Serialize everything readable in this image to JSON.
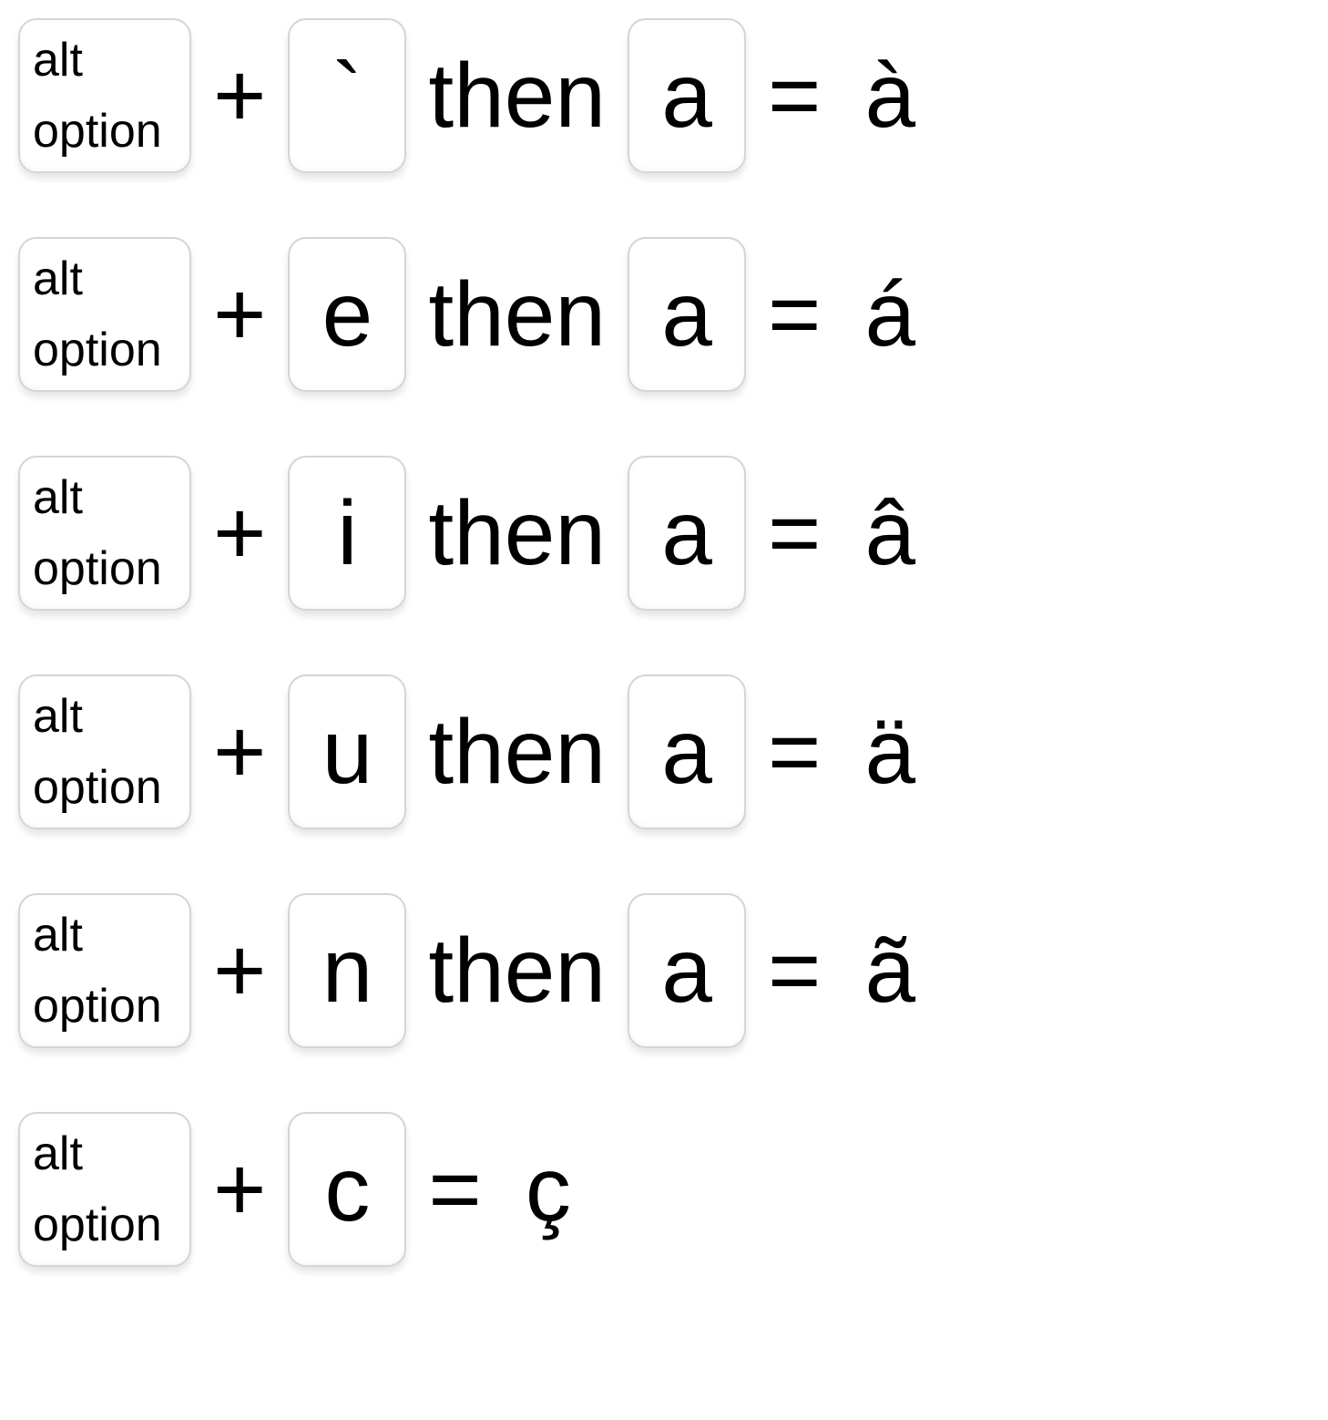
{
  "rows": [
    {
      "alt_top": "alt",
      "alt_bottom": "option",
      "plus": "+",
      "k1": "`",
      "then": "then",
      "k2": "a",
      "eq": "=",
      "out": "à"
    },
    {
      "alt_top": "alt",
      "alt_bottom": "option",
      "plus": "+",
      "k1": "e",
      "then": "then",
      "k2": "a",
      "eq": "=",
      "out": "á"
    },
    {
      "alt_top": "alt",
      "alt_bottom": "option",
      "plus": "+",
      "k1": "i",
      "then": "then",
      "k2": "a",
      "eq": "=",
      "out": "â"
    },
    {
      "alt_top": "alt",
      "alt_bottom": "option",
      "plus": "+",
      "k1": "u",
      "then": "then",
      "k2": "a",
      "eq": "=",
      "out": "ä"
    },
    {
      "alt_top": "alt",
      "alt_bottom": "option",
      "plus": "+",
      "k1": "n",
      "then": "then",
      "k2": "a",
      "eq": "=",
      "out": "ã"
    },
    {
      "alt_top": "alt",
      "alt_bottom": "option",
      "plus": "+",
      "k1": "c",
      "then": null,
      "k2": null,
      "eq": "=",
      "out": "ç"
    }
  ]
}
